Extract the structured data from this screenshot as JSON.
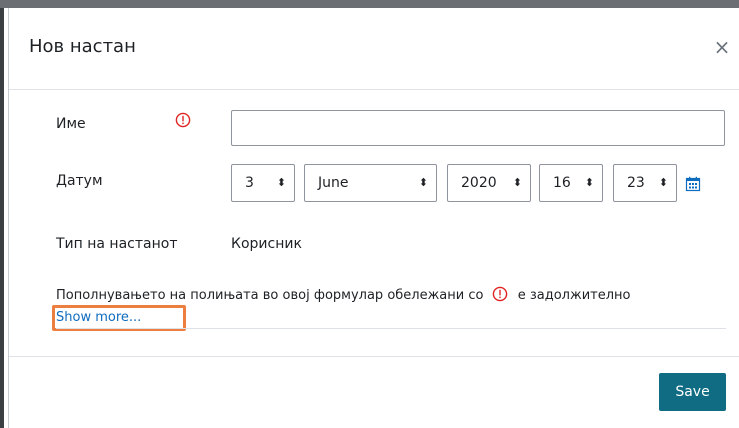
{
  "modal": {
    "title": "Нов настан",
    "close_glyph": "×"
  },
  "form": {
    "name": {
      "label": "Име",
      "value": "",
      "required_icon": "exclamation-circle-icon",
      "required_color": "#e02424"
    },
    "date": {
      "label": "Датум",
      "day": "3",
      "month": "June",
      "year": "2020",
      "hour": "16",
      "minute": "23",
      "calendar_icon": "calendar-icon"
    },
    "event_type": {
      "label": "Тип на настанот",
      "value": "Корисник"
    },
    "required_notice_before": "Пополнувањето на полињата во овој формулар обележани со",
    "required_notice_after": "е задолжително",
    "show_more": "Show more..."
  },
  "footer": {
    "save_label": "Save"
  },
  "colors": {
    "accent": "#0f6c83",
    "link": "#0f6cbf",
    "required": "#e02424",
    "highlight": "#ec7f3f"
  }
}
